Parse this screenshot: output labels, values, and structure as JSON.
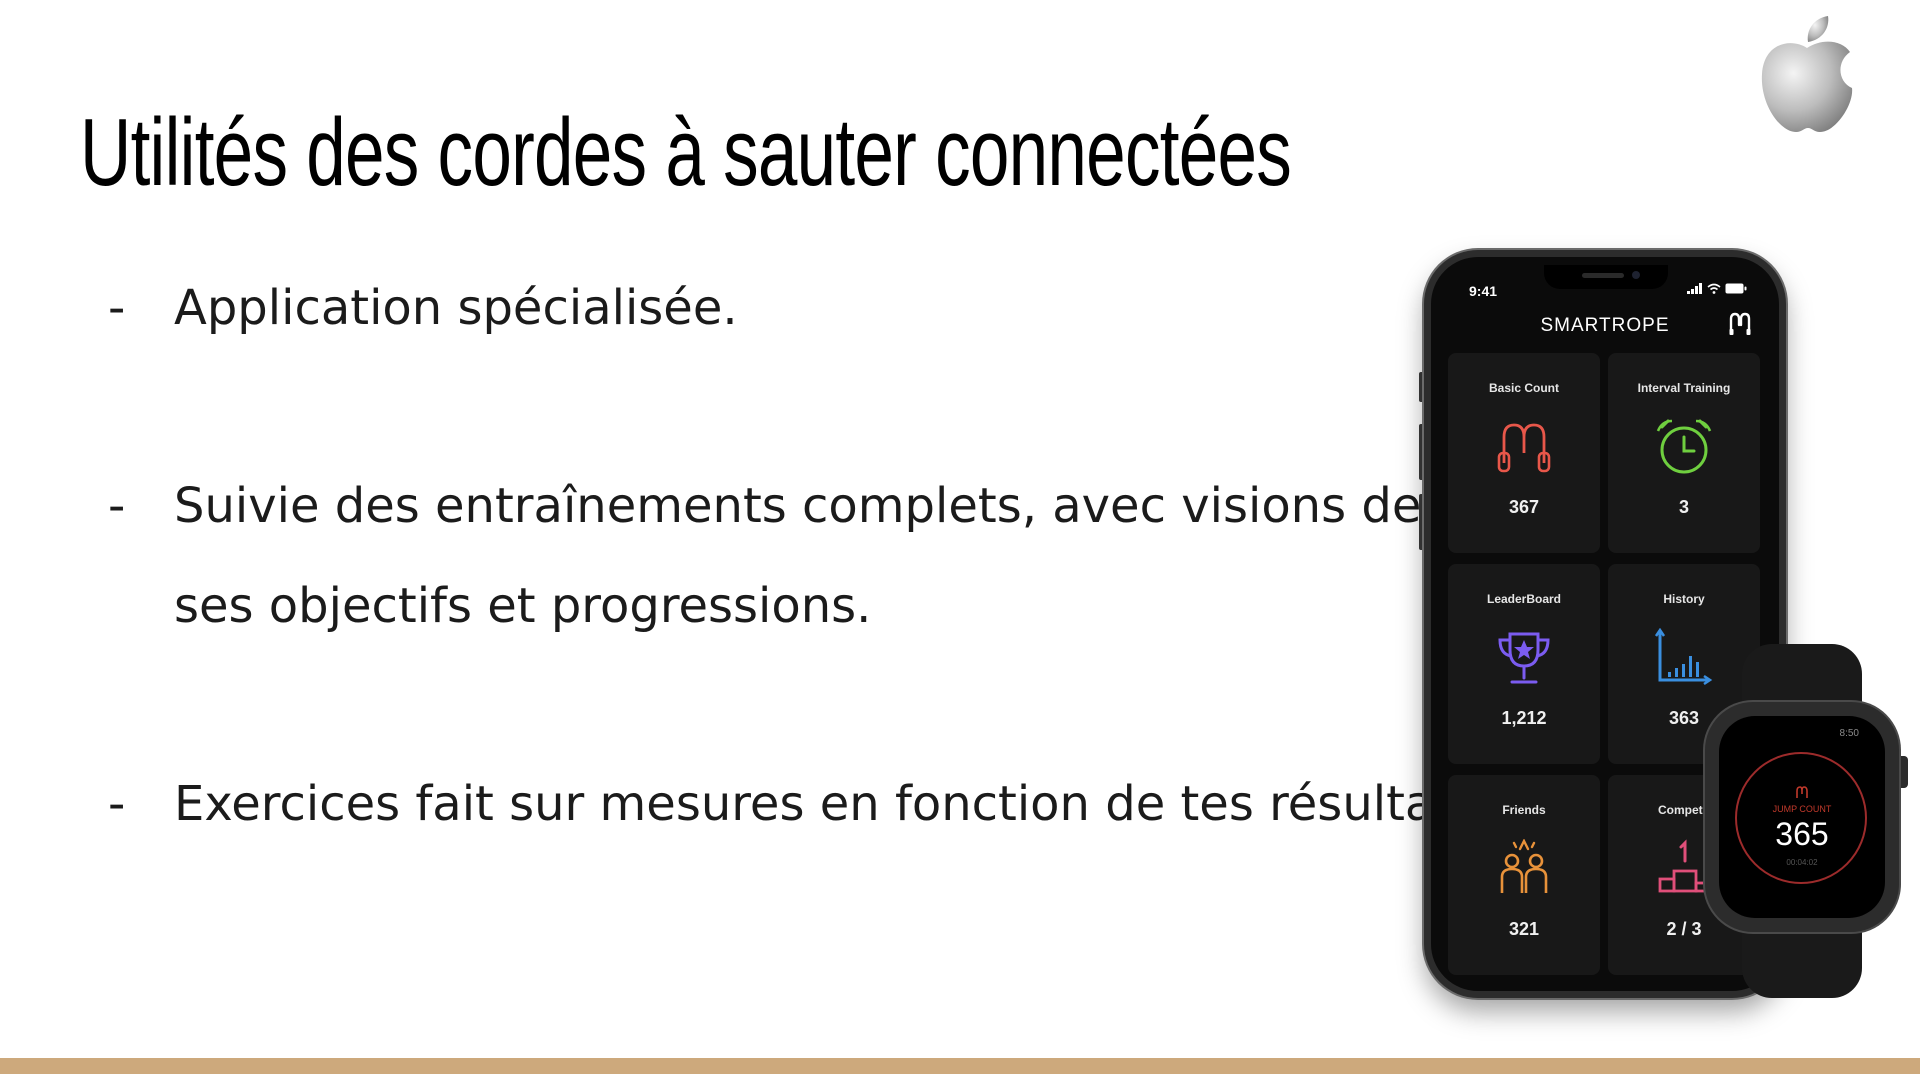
{
  "slide": {
    "title": "Utilités des cordes à sauter connectées",
    "bullets": [
      {
        "marker": "-",
        "text": "Application spécialisée."
      },
      {
        "marker": "-",
        "text": "Suivie des entraînements complets, avec visions de",
        "text_line2": "ses objectifs et progressions."
      },
      {
        "marker": "-",
        "text": "Exercices fait sur mesures en fonction de tes résultats."
      }
    ],
    "logo_icon": "apple-logo-icon",
    "footer_color": "#cda97c"
  },
  "phone": {
    "status_time": "9:41",
    "app_title": "SMARTROPE",
    "tiles": [
      {
        "label": "Basic Count",
        "value": "367",
        "icon": "jump-rope-icon",
        "color": "#e8574a"
      },
      {
        "label": "Interval Training",
        "value": "3",
        "icon": "alarm-clock-icon",
        "color": "#6fcf3f"
      },
      {
        "label": "LeaderBoard",
        "value": "1,212",
        "icon": "trophy-icon",
        "color": "#7b5cf0"
      },
      {
        "label": "History",
        "value": "363",
        "icon": "bar-chart-icon",
        "color": "#3a8fe0"
      },
      {
        "label": "Friends",
        "value": "321",
        "icon": "friends-icon",
        "color": "#e8923a"
      },
      {
        "label": "Competit",
        "value": "2 / 3",
        "icon": "podium-icon",
        "color": "#e04f7a"
      }
    ]
  },
  "watch": {
    "time": "8:50",
    "label": "JUMP COUNT",
    "count": "365",
    "elapsed": "00:04:02"
  }
}
